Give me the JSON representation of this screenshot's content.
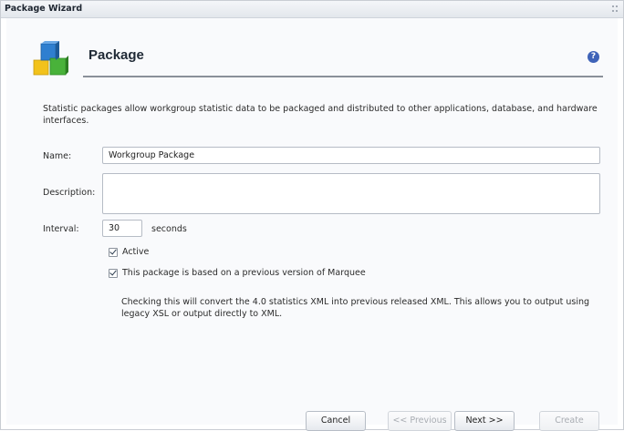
{
  "window": {
    "title": "Package Wizard"
  },
  "header": {
    "title": "Package",
    "help_symbol": "?"
  },
  "intro_text": "Statistic packages allow workgroup statistic data to be packaged and distributed to other applications, database, and hardware interfaces.",
  "form": {
    "name_label": "Name:",
    "name_value": "Workgroup Package",
    "description_label": "Description:",
    "description_value": "",
    "interval_label": "Interval:",
    "interval_value": "30",
    "interval_unit": "seconds",
    "active_label": "Active",
    "active_checked": true,
    "previous_version_label": "This package is based on a previous version of Marquee",
    "previous_version_checked": true,
    "previous_version_note": "Checking this will convert the 4.0 statistics XML into previous released XML. This allows you to output using legacy XSL or output directly to XML."
  },
  "buttons": {
    "cancel": "Cancel",
    "previous": "<< Previous",
    "next": "Next >>",
    "create": "Create"
  },
  "icons": {
    "header": "package-blocks-icon",
    "help": "help-icon",
    "checkbox": "checkmark-icon"
  }
}
